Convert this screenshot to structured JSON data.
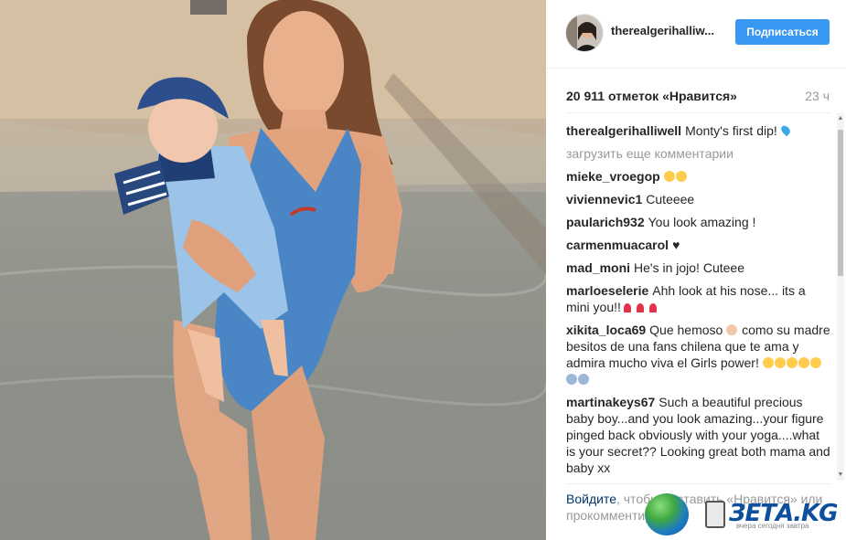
{
  "post": {
    "username": "therealgerihalliw...",
    "follow_label": "Подписаться",
    "likes": "20 911 отметок «Нравится»",
    "time": "23 ч"
  },
  "comments": {
    "caption_user": "therealgerihalliwell",
    "caption_text": "Monty's first dip!",
    "load_more": "загрузить еще комментарии",
    "items": [
      {
        "user": "mieke_vroegop",
        "text": ""
      },
      {
        "user": "viviennevic1",
        "text": "Cuteeee"
      },
      {
        "user": "paularich932",
        "text": "You look amazing !"
      },
      {
        "user": "carmenmuacarol",
        "text": "♥"
      },
      {
        "user": "mad_moni",
        "text": "He's in jojo! Cuteee"
      },
      {
        "user": "marloeselerie",
        "text": "Ahh look at his nose... its a mini you!!"
      },
      {
        "user": "xikita_loca69",
        "text": "Que hemoso",
        "text2": "como su madre besitos de una fans chilena que te ama y admira mucho viva el Girls power!"
      },
      {
        "user": "martinakeys67",
        "text": "Such a beautiful precious baby boy...and you look amazing...your figure pinged back obviously with your yoga....what is your secret?? Looking great both mama and baby xx"
      }
    ]
  },
  "footer": {
    "login": "Войдите",
    "text": ", чтобы поставить «Нравится» или прокомментировать."
  },
  "watermark": {
    "brand": "ЗЕТА.KG",
    "sub": "вчера сегодня завтра"
  },
  "colors": {
    "accent": "#3897f0",
    "swimsuit": "#4a86c5"
  }
}
